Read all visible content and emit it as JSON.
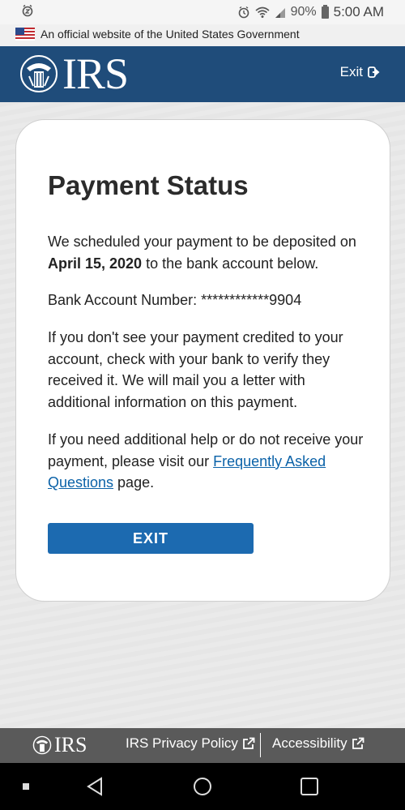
{
  "status_bar": {
    "battery": "90%",
    "time": "5:00 AM"
  },
  "gov_banner": {
    "text": "An official website of the United States Government"
  },
  "header": {
    "logo_text": "IRS",
    "exit_label": "Exit"
  },
  "card": {
    "title": "Payment Status",
    "p1_before": "We scheduled your payment to be deposited on ",
    "p1_date": "April 15, 2020",
    "p1_after": " to the bank account below.",
    "bank_account": "Bank Account Number: ************9904",
    "p3": "If you don't see your payment credited to your account, check with your bank to verify they received it. We will mail you a letter with additional information on this payment.",
    "p4_before": "If you need additional help or do not receive your payment, please visit our ",
    "p4_link": "Frequently Asked Questions",
    "p4_after": " page.",
    "button_label": "EXIT"
  },
  "footer": {
    "logo_text": "IRS",
    "privacy_label": "IRS Privacy Policy",
    "accessibility_label": "Accessibility"
  },
  "colors": {
    "header": "#1f4c7a",
    "button": "#1c6ab0",
    "link": "#0b62a8",
    "footer": "#5a5a5a"
  }
}
